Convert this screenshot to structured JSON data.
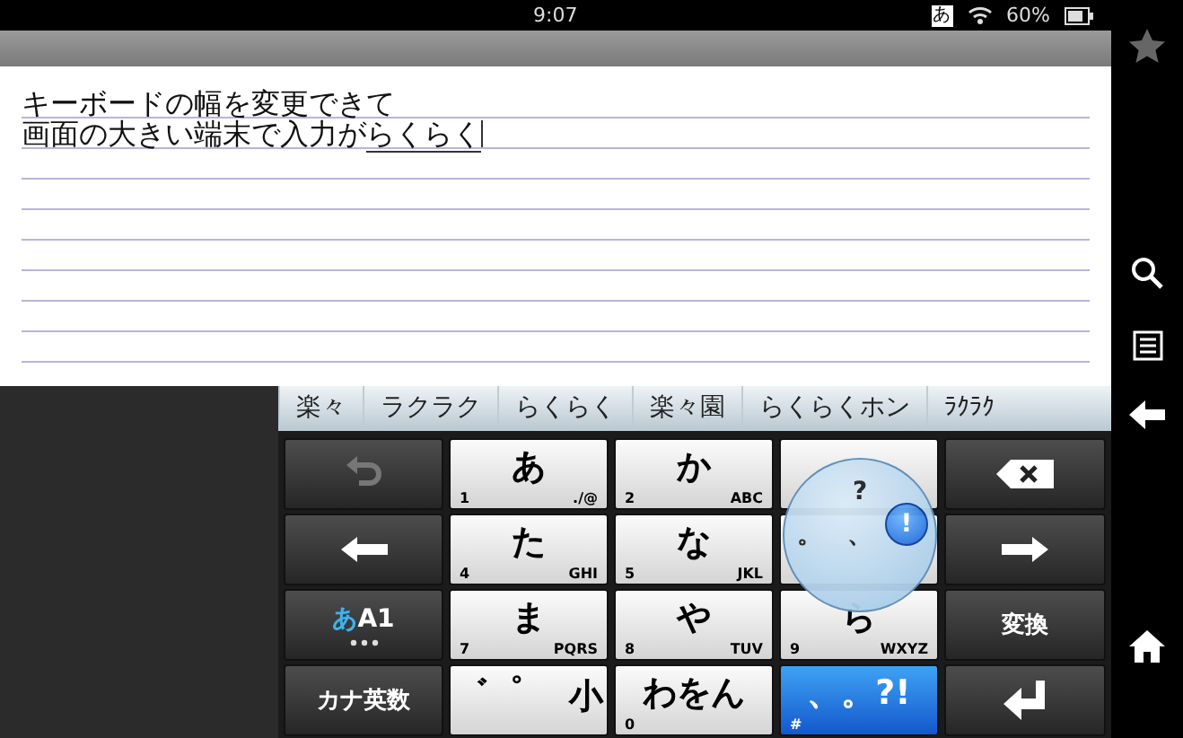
{
  "status_bar": {
    "time": "9:07",
    "ime_indicator": "あ",
    "battery": "60%"
  },
  "editor": {
    "lines": [
      {
        "text": "キーボードの幅を変更できて"
      },
      {
        "text": "画面の大きい端末で入力が",
        "composing": "らくらく"
      }
    ]
  },
  "candidates": [
    {
      "text": "楽々"
    },
    {
      "text": "ラクラク"
    },
    {
      "text": "らくらく"
    },
    {
      "text": "楽々園"
    },
    {
      "text": "らくらくホン"
    },
    {
      "text": "ﾗｸﾗｸ"
    }
  ],
  "keys": [
    {
      "kind": "undo",
      "pressed": false
    },
    {
      "kind": "kana",
      "main": "あ",
      "num": "1",
      "letters": "./@",
      "pressed": false
    },
    {
      "kind": "kana",
      "main": "か",
      "num": "2",
      "letters": "ABC",
      "pressed": false
    },
    {
      "kind": "kana",
      "pressed": false
    },
    {
      "kind": "backspace",
      "pressed": false
    },
    {
      "kind": "left",
      "pressed": false
    },
    {
      "kind": "kana",
      "main": "た",
      "num": "4",
      "letters": "GHI",
      "pressed": false
    },
    {
      "kind": "kana",
      "main": "な",
      "num": "5",
      "letters": "JKL",
      "pressed": false
    },
    {
      "kind": "kana",
      "pressed": false
    },
    {
      "kind": "right",
      "pressed": false
    },
    {
      "kind": "mode",
      "main": "あ",
      "sub": "A1",
      "pressed": false
    },
    {
      "kind": "kana",
      "main": "ま",
      "num": "7",
      "letters": "PQRS",
      "pressed": false
    },
    {
      "kind": "kana",
      "main": "や",
      "num": "8",
      "letters": "TUV",
      "pressed": false
    },
    {
      "kind": "kana",
      "main": "ら",
      "num": "9",
      "letters": "WXYZ",
      "pressed": false
    },
    {
      "kind": "text",
      "main": "変換",
      "pressed": false
    },
    {
      "kind": "text",
      "main": "カナ英数",
      "pressed": false
    },
    {
      "kind": "kana",
      "main": "゛゜",
      "side": "小",
      "pressed": false
    },
    {
      "kind": "kana",
      "main": "わをん",
      "num": "0",
      "pressed": false
    },
    {
      "kind": "kana",
      "main": "、。?!",
      "num": "#",
      "pressed": true
    },
    {
      "kind": "enter",
      "pressed": false
    }
  ],
  "flick_popup": {
    "petals": [
      {
        "text": "?",
        "selected": false
      },
      {
        "text": "。",
        "selected": false
      },
      {
        "text": "、",
        "selected": false
      },
      {
        "text": "!",
        "selected": true
      }
    ]
  }
}
